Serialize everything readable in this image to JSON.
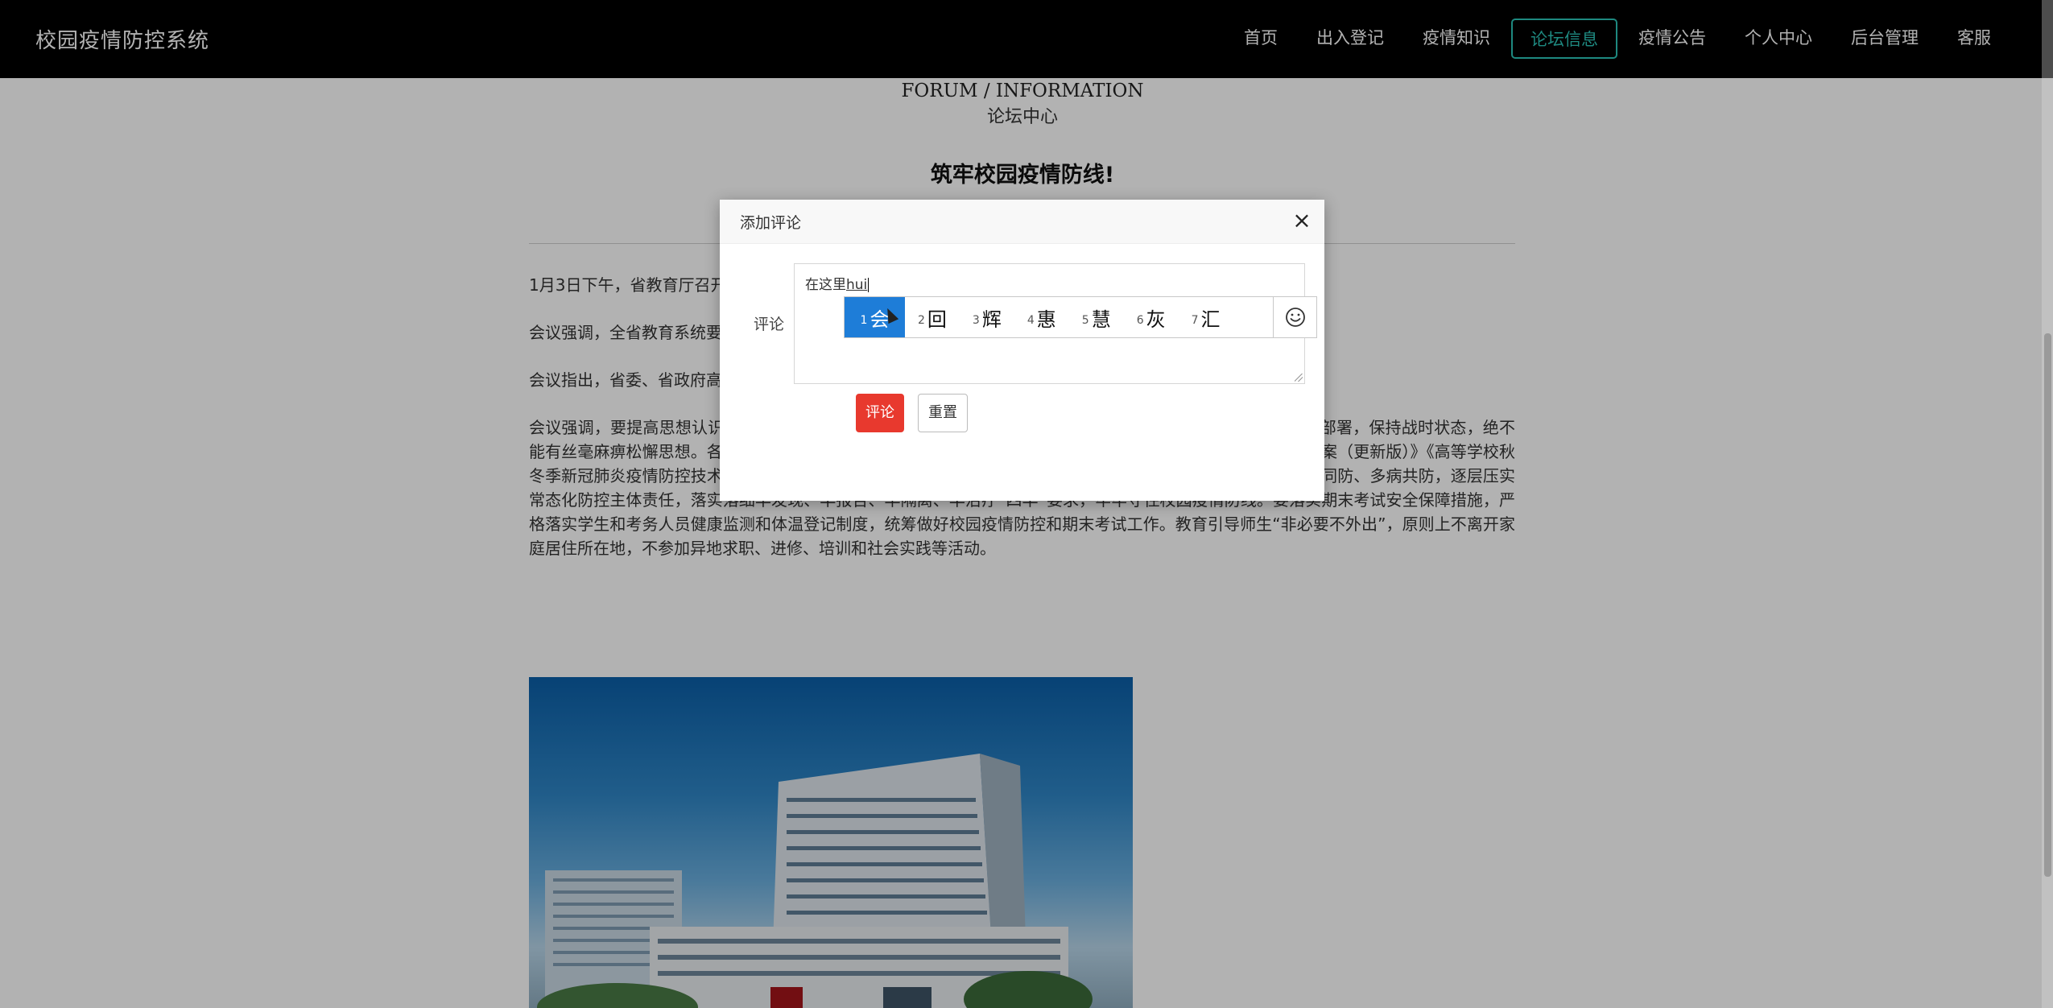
{
  "app": {
    "brand": "校园疫情防控系统"
  },
  "nav": {
    "items": [
      "首页",
      "出入登记",
      "疫情知识",
      "论坛信息",
      "疫情公告",
      "个人中心",
      "后台管理",
      "客服"
    ],
    "active": "论坛信息"
  },
  "section": {
    "english": "FORUM / INFORMATION",
    "chinese": "论坛中心"
  },
  "post": {
    "title": "筑牢校园疫情防线!",
    "paragraphs": [
      "1月3日下午，省教育厅召开 … 小组会议精神，安排部署全省教育系统疫情防控工作。",
      "会议强调，全省教育系统要 … 防范化解，筑牢织密校园疫情防线，切实维护校园安全 …",
      "会议指出，省委、省政府高 … 东峰书记、许勤省长要求全省各级各部门要清醒认识当 … 实做细做到位。",
      "会议强调，要提高思想认识 … 在当地党委和政府领导下，加强组织领导，认真履行部门责任，及时研判、及时部署，保持战时状态，绝不能有丝毫麻痹松懈思想。各学校要严格落实国家卫健委、教育部发布的《中小学秋冬季新冠肺炎疫情防控技术方案（更新版）》《高等学校秋冬季新冠肺炎疫情防控技术方案（更新版）》《托幼机构秋冬季新冠肺炎疫情防控技术方案（更新版）》，坚持人物同防、多病共防，逐层压实常态化防控主体责任，落实落细早发现、早报告、早隔离、早治疗“四早”要求，牢牢守住校园疫情防线。要落实期末考试安全保障措施，严格落实学生和考务人员健康监测和体温登记制度，统筹做好校园疫情防控和期末考试工作。教育引导师生“非必要不外出”，原则上不离开家庭居住所在地，不参加异地求职、进修、培训和社会实践等活动。"
    ]
  },
  "modal": {
    "title": "添加评论",
    "close": "×",
    "label": "评论",
    "input_text": "在这里",
    "input_typed": "hui",
    "submit_label": "评论",
    "reset_label": "重置"
  },
  "ime": {
    "candidates": [
      {
        "num": "1",
        "char": "会"
      },
      {
        "num": "2",
        "char": "回"
      },
      {
        "num": "3",
        "char": "辉"
      },
      {
        "num": "4",
        "char": "惠"
      },
      {
        "num": "5",
        "char": "慧"
      },
      {
        "num": "6",
        "char": "灰"
      },
      {
        "num": "7",
        "char": "汇"
      }
    ],
    "emoji_icon": "smiley-icon"
  },
  "colors": {
    "nav_bg": "#000000",
    "nav_active": "#2cc4b8",
    "submit_button": "#e8392e",
    "ime_highlight": "#1e7dd8"
  }
}
